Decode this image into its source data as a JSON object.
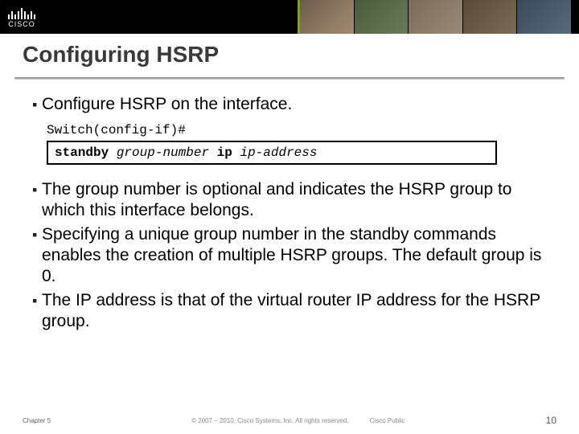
{
  "brand": {
    "name": "CISCO"
  },
  "title": "Configuring HSRP",
  "intro_bullet": "Configure HSRP on the interface.",
  "cli": {
    "prompt": "Switch(config-if)#",
    "cmd_bold1": "standby",
    "cmd_italic1": "group-number",
    "cmd_bold2": "ip",
    "cmd_italic2": "ip-address"
  },
  "bullets": [
    "The group number is optional and indicates the HSRP group to which this interface belongs.",
    "Specifying a unique group number in the standby commands enables the creation of multiple HSRP groups. The default group is 0.",
    "The IP address is that of the virtual router IP address for the HSRP group."
  ],
  "footer": {
    "chapter": "Chapter 5",
    "copyright": "© 2007 – 2010, Cisco Systems, Inc. All rights reserved.",
    "classification": "Cisco Public",
    "page": "10"
  }
}
